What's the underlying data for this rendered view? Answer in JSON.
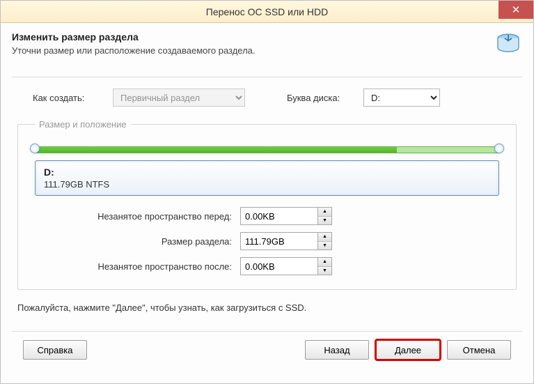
{
  "window": {
    "title": "Перенос ОС SSD или HDD"
  },
  "header": {
    "title": "Изменить размер раздела",
    "subtitle": "Уточни размер или расположение создаваемого раздела."
  },
  "controls": {
    "create_label": "Как создать:",
    "create_value": "Первичный раздел",
    "drive_letter_label": "Буква диска:",
    "drive_letter_value": "D:"
  },
  "group": {
    "legend": "Размер и положение",
    "slider": {
      "fill_percent": 78
    },
    "partition": {
      "name": "D:",
      "info": "111.79GB NTFS"
    },
    "fields": {
      "before_label": "Незанятое пространство перед:",
      "before_value": "0.00KB",
      "size_label": "Размер раздела:",
      "size_value": "111.79GB",
      "after_label": "Незанятое пространство после:",
      "after_value": "0.00KB"
    }
  },
  "hint": "Пожалуйста, нажмите \"Далее\", чтобы узнать, как загрузиться с SSD.",
  "footer": {
    "help": "Справка",
    "back": "Назад",
    "next": "Далее",
    "cancel": "Отмена"
  }
}
